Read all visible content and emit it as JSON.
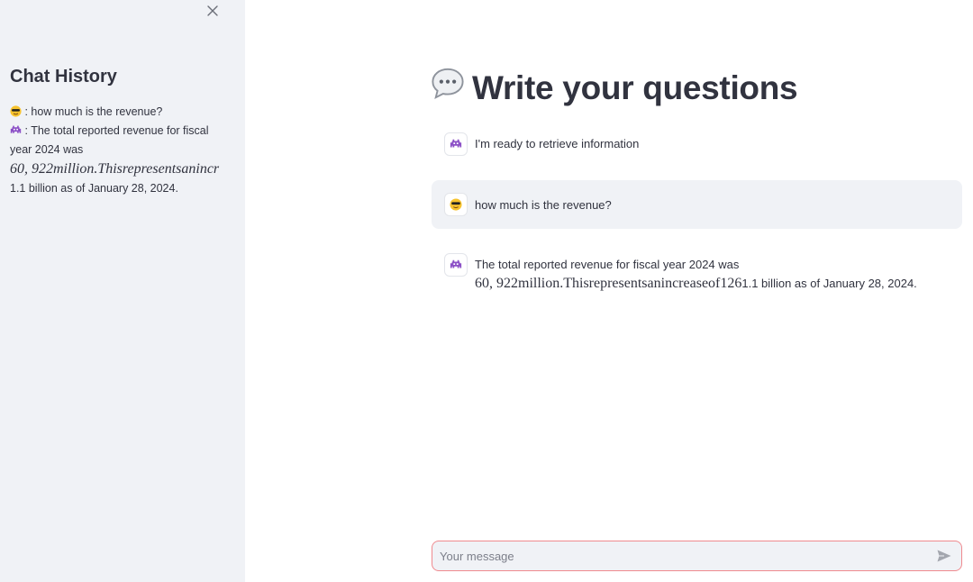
{
  "sidebar": {
    "title": "Chat History",
    "close_icon": "close-icon",
    "history": [
      {
        "role_icon": "sunglasses-face-icon",
        "text": ": how much is the revenue?"
      },
      {
        "role_icon": "alien-monster-icon",
        "text": ": The total reported revenue for fiscal year 2024 was"
      }
    ],
    "history_math": "60, 922million.Thisrepresentsanincr",
    "history_tail": "1.1 billion as of January 28, 2024."
  },
  "main": {
    "title": "Write your questions",
    "title_icon": "speech-bubble-icon"
  },
  "messages": {
    "assistant_greeting": {
      "avatar": "alien-monster-icon",
      "text": "I'm ready to retrieve information"
    },
    "user_question": {
      "avatar": "sunglasses-face-icon",
      "text": "how much is the revenue?"
    },
    "assistant_answer": {
      "avatar": "alien-monster-icon",
      "line1": "The total reported revenue for fiscal year 2024 was",
      "math_number": "60, 922",
      "math_italic": "million.Thisrepresentsanincreaseof",
      "math_tail_number": "126",
      "tail": "1.1 billion as of January 28, 2024."
    }
  },
  "chat_input": {
    "placeholder": "Your message",
    "send_icon": "send-icon"
  },
  "colors": {
    "sidebar_bg": "#f0f2f6",
    "text": "#31333f",
    "input_border": "#ef8a8f"
  }
}
